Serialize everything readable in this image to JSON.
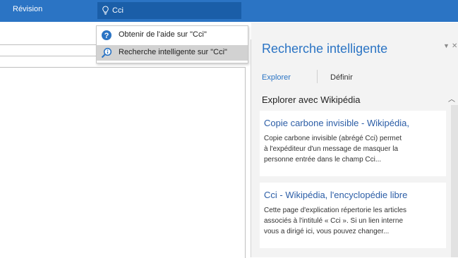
{
  "ribbon": {
    "tab_label": "Révision",
    "tell_me": {
      "value": "Cci"
    },
    "colors": {
      "ribbon": "#2b74c4",
      "tell_me_box": "#1a5ea8"
    }
  },
  "dropdown": {
    "items": [
      {
        "label": "Obtenir de l'aide sur \"Cci\"",
        "icon": "help-question-icon",
        "selected": false
      },
      {
        "label": "Recherche intelligente sur \"Cci\"",
        "icon": "smart-lookup-icon",
        "selected": true
      }
    ]
  },
  "smart_lookup": {
    "title": "Recherche intelligente",
    "tabs": [
      {
        "label": "Explorer",
        "active": true
      },
      {
        "label": "Définir",
        "active": false
      }
    ],
    "section_title": "Explorer avec Wikipédia",
    "results": [
      {
        "title": "Copie carbone invisible - Wikipédia,",
        "snippet_lines": [
          "Copie carbone invisible (abrégé Cci) permet",
          "à l'expéditeur d'un message de masquer la",
          "personne entrée dans le champ Cci..."
        ]
      },
      {
        "title": "Cci - Wikipédia, l'encyclopédie libre",
        "snippet_lines": [
          "Cette page d'explication répertorie les articles",
          "associés à l'intitulé « Cci ». Si un lien interne",
          "vous a dirigé ici, vous pouvez changer..."
        ]
      }
    ],
    "colors": {
      "accent": "#2b74c4",
      "link": "#2b5da6",
      "pane_bg": "#f3f3f3"
    }
  }
}
